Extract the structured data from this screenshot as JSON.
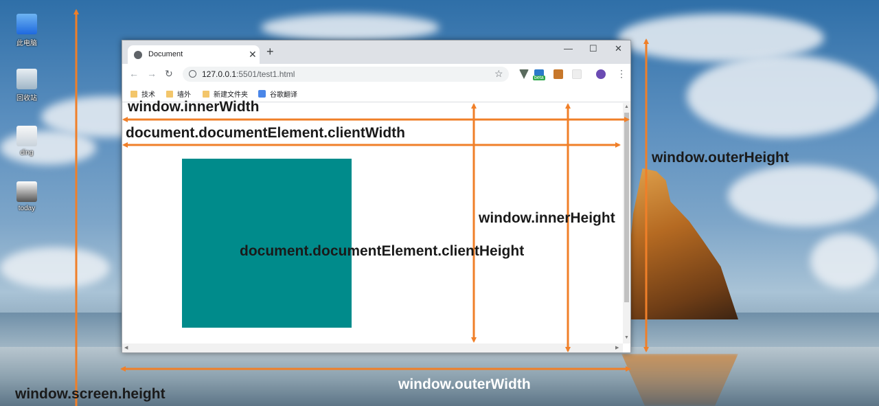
{
  "desktop": {
    "icons": [
      {
        "label": "此电脑",
        "icon": "computer-icon"
      },
      {
        "label": "回收站",
        "icon": "recycle-bin-icon"
      },
      {
        "label": "ding",
        "icon": "folder-icon"
      },
      {
        "label": "today",
        "icon": "shortcut-icon"
      }
    ]
  },
  "browser": {
    "tab_title": "Document",
    "tab_close": "✕",
    "new_tab": "+",
    "window_controls": {
      "minimize": "—",
      "maximize": "☐",
      "close": "✕"
    },
    "nav": {
      "back": "←",
      "forward": "→",
      "reload": "↻"
    },
    "url_host": "127.0.0.1",
    "url_rest": ":5501/test1.html",
    "star": "☆",
    "extensions": [
      "vue-devtools-icon",
      "beta-extension-icon",
      "book-extension-icon",
      "blank-extension-icon",
      "profile-avatar-icon",
      "kebab-menu-icon"
    ],
    "ext_badge": "beta",
    "menu": "⋮",
    "bookmarks": [
      {
        "label": "技术",
        "icon": "folder-icon"
      },
      {
        "label": "墙外",
        "icon": "folder-icon"
      },
      {
        "label": "新建文件夹",
        "icon": "folder-icon"
      },
      {
        "label": "谷歌翻译",
        "icon": "google-translate-icon"
      }
    ],
    "page_box_color": "#008b8b"
  },
  "annotations": {
    "inner_width": "window.innerWidth",
    "client_width": "document.documentElement.clientWidth",
    "outer_height": "window.outerHeight",
    "inner_height": "window.innerHeight",
    "client_height": "document.documentElement.clientHeight",
    "screen_height": "window.screen.height",
    "outer_width": "window.outerWidth",
    "arrow_color": "#f07f28"
  }
}
